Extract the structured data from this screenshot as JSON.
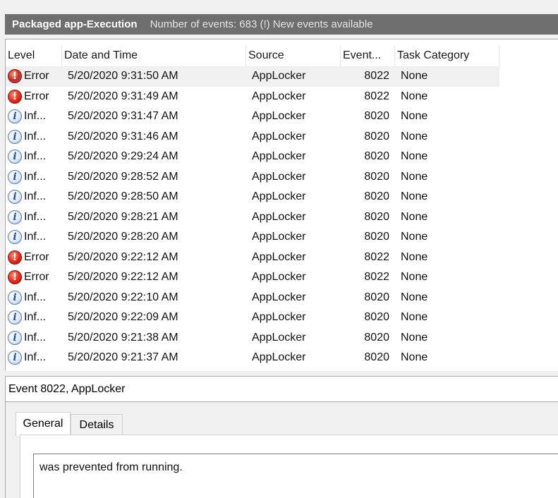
{
  "header": {
    "log_name": "Packaged app-Execution",
    "event_count_text": "Number of events: 683 (!) New events available"
  },
  "columns": {
    "level": "Level",
    "date_time": "Date and Time",
    "source": "Source",
    "event_id": "Event...",
    "task_category": "Task Category"
  },
  "events": [
    {
      "level": "error",
      "level_label": "Error",
      "date_time": "5/20/2020 9:31:50 AM",
      "source": "AppLocker",
      "event_id": "8022",
      "task_category": "None",
      "selected": true
    },
    {
      "level": "error",
      "level_label": "Error",
      "date_time": "5/20/2020 9:31:49 AM",
      "source": "AppLocker",
      "event_id": "8022",
      "task_category": "None"
    },
    {
      "level": "info",
      "level_label": "Inf...",
      "date_time": "5/20/2020 9:31:47 AM",
      "source": "AppLocker",
      "event_id": "8020",
      "task_category": "None"
    },
    {
      "level": "info",
      "level_label": "Inf...",
      "date_time": "5/20/2020 9:31:46 AM",
      "source": "AppLocker",
      "event_id": "8020",
      "task_category": "None"
    },
    {
      "level": "info",
      "level_label": "Inf...",
      "date_time": "5/20/2020 9:29:24 AM",
      "source": "AppLocker",
      "event_id": "8020",
      "task_category": "None"
    },
    {
      "level": "info",
      "level_label": "Inf...",
      "date_time": "5/20/2020 9:28:52 AM",
      "source": "AppLocker",
      "event_id": "8020",
      "task_category": "None"
    },
    {
      "level": "info",
      "level_label": "Inf...",
      "date_time": "5/20/2020 9:28:50 AM",
      "source": "AppLocker",
      "event_id": "8020",
      "task_category": "None"
    },
    {
      "level": "info",
      "level_label": "Inf...",
      "date_time": "5/20/2020 9:28:21 AM",
      "source": "AppLocker",
      "event_id": "8020",
      "task_category": "None"
    },
    {
      "level": "info",
      "level_label": "Inf...",
      "date_time": "5/20/2020 9:28:20 AM",
      "source": "AppLocker",
      "event_id": "8020",
      "task_category": "None"
    },
    {
      "level": "error",
      "level_label": "Error",
      "date_time": "5/20/2020 9:22:12 AM",
      "source": "AppLocker",
      "event_id": "8022",
      "task_category": "None"
    },
    {
      "level": "error",
      "level_label": "Error",
      "date_time": "5/20/2020 9:22:12 AM",
      "source": "AppLocker",
      "event_id": "8022",
      "task_category": "None"
    },
    {
      "level": "info",
      "level_label": "Inf...",
      "date_time": "5/20/2020 9:22:10 AM",
      "source": "AppLocker",
      "event_id": "8020",
      "task_category": "None"
    },
    {
      "level": "info",
      "level_label": "Inf...",
      "date_time": "5/20/2020 9:22:09 AM",
      "source": "AppLocker",
      "event_id": "8020",
      "task_category": "None"
    },
    {
      "level": "info",
      "level_label": "Inf...",
      "date_time": "5/20/2020 9:21:38 AM",
      "source": "AppLocker",
      "event_id": "8020",
      "task_category": "None"
    },
    {
      "level": "info",
      "level_label": "Inf...",
      "date_time": "5/20/2020 9:21:37 AM",
      "source": "AppLocker",
      "event_id": "8020",
      "task_category": "None"
    }
  ],
  "icons": {
    "error": "error-icon",
    "info": "info-icon"
  },
  "details": {
    "event_title": "Event 8022, AppLocker",
    "tabs": [
      {
        "label": "General",
        "active": true
      },
      {
        "label": "Details",
        "active": false
      }
    ],
    "description": "was prevented from running."
  },
  "colors": {
    "header_bg": "#6e6e6e",
    "selected_row_bg": "#f0f0f0",
    "error_red": "#e02a1a",
    "info_blue": "#1e4f96"
  }
}
